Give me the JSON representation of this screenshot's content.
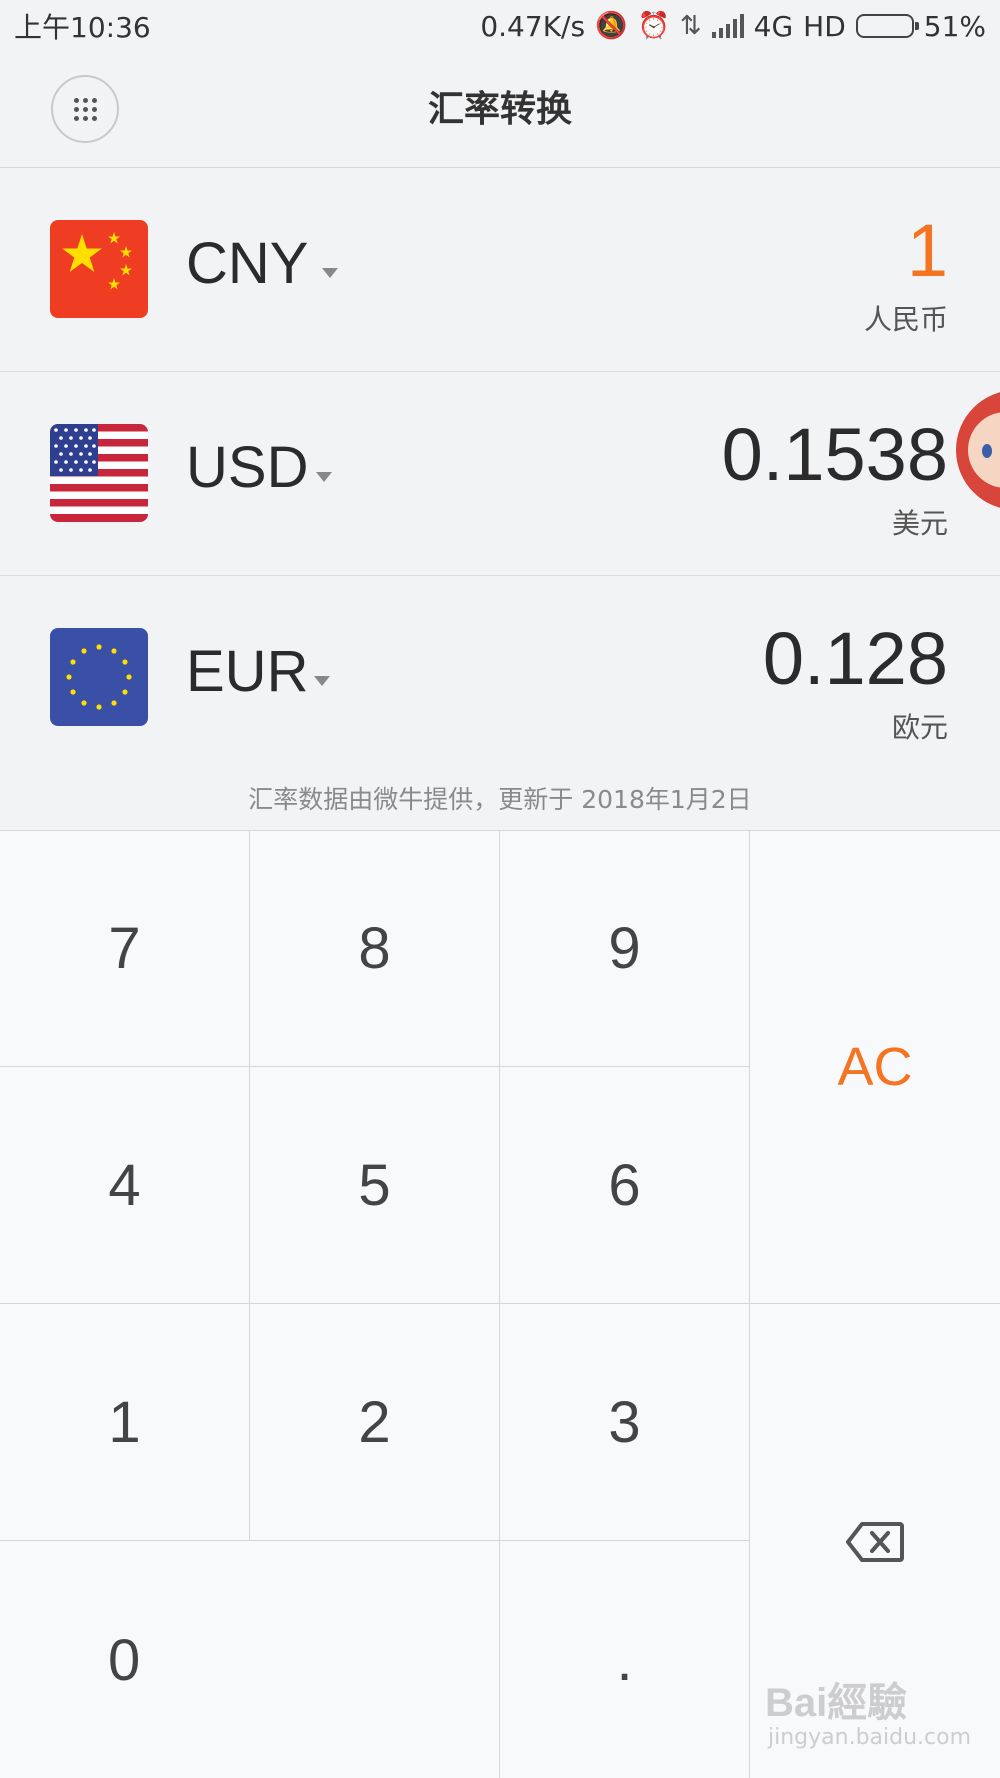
{
  "status_bar": {
    "time": "上午10:36",
    "net_speed": "0.47K/s",
    "network": "4G",
    "hd": "HD",
    "battery": "51%"
  },
  "header": {
    "title": "汇率转换"
  },
  "currencies": [
    {
      "code": "CNY",
      "amount": "1",
      "name": "人民币",
      "flag": "china-flag",
      "active": true
    },
    {
      "code": "USD",
      "amount": "0.1538",
      "name": "美元",
      "flag": "usa-flag",
      "active": false
    },
    {
      "code": "EUR",
      "amount": "0.128",
      "name": "欧元",
      "flag": "eu-flag",
      "active": false
    }
  ],
  "source_note": "汇率数据由微牛提供，更新于 2018年1月2日",
  "keypad": {
    "k7": "7",
    "k8": "8",
    "k9": "9",
    "k4": "4",
    "k5": "5",
    "k6": "6",
    "k1": "1",
    "k2": "2",
    "k3": "3",
    "k0": "0",
    "dot": ".",
    "ac": "AC",
    "backspace_icon": "backspace-icon"
  },
  "watermark": {
    "text": "Bai經驗",
    "url": "jingyan.baidu.com"
  },
  "colors": {
    "accent": "#f47422",
    "background": "#f2f3f4",
    "keypad_bg": "#f8f9fb"
  }
}
